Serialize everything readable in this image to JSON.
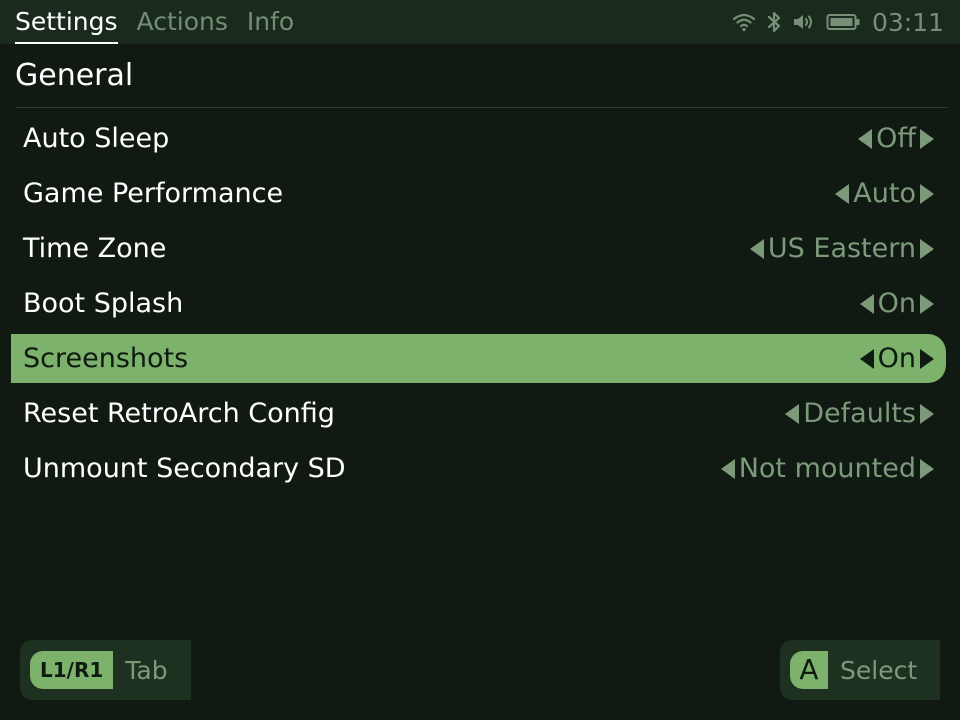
{
  "topbar": {
    "tabs": [
      {
        "label": "Settings",
        "active": true
      },
      {
        "label": "Actions",
        "active": false
      },
      {
        "label": "Info",
        "active": false
      }
    ],
    "status": {
      "icons": [
        "wifi-icon",
        "bluetooth-icon",
        "volume-icon",
        "battery-icon"
      ],
      "time": "03:11"
    }
  },
  "section": {
    "title": "General"
  },
  "settings": [
    {
      "label": "Auto Sleep",
      "value": "Off",
      "selected": false
    },
    {
      "label": "Game Performance",
      "value": "Auto",
      "selected": false
    },
    {
      "label": "Time Zone",
      "value": "US Eastern",
      "selected": false
    },
    {
      "label": "Boot Splash",
      "value": "On",
      "selected": false
    },
    {
      "label": "Screenshots",
      "value": "On",
      "selected": true
    },
    {
      "label": "Reset RetroArch Config",
      "value": "Defaults",
      "selected": false
    },
    {
      "label": "Unmount Secondary SD",
      "value": "Not mounted",
      "selected": false
    }
  ],
  "hints": {
    "left": {
      "button": "L1/R1",
      "action": "Tab"
    },
    "right": {
      "button": "A",
      "action": "Select"
    }
  },
  "colors": {
    "background": "#101a12",
    "topbar": "#1a2a1d",
    "accent": "#7cb26b",
    "muted_text": "#7c9a7a"
  }
}
